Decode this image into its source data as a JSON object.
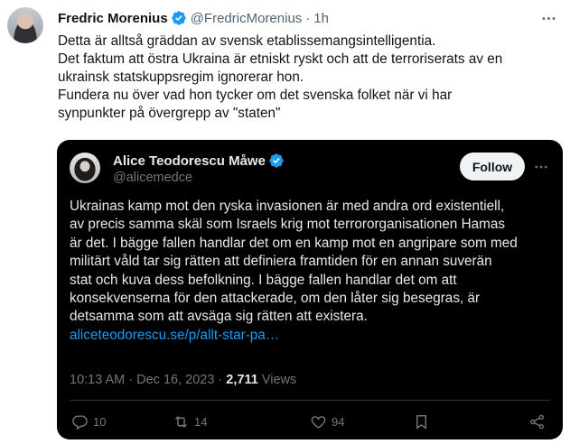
{
  "tweet": {
    "author_name": "Fredric Morenius",
    "author_handle": "@FredricMorenius",
    "separator": "·",
    "time": "1h",
    "text_lines": [
      "Detta är alltså gräddan av svensk etablissemangsintelligentia.",
      "Det faktum att östra Ukraina är etniskt ryskt och att de terroriserats av en",
      "ukrainsk statskuppsregim ignorerar hon.",
      "Fundera nu över vad hon tycker om det svenska folket när vi har",
      "synpunkter på övergrepp av \"staten\""
    ]
  },
  "quote": {
    "author_name": "Alice Teodorescu Måwe",
    "author_handle": "@alicemedce",
    "follow_label": "Follow",
    "text_lines": [
      "Ukrainas kamp mot den ryska invasionen är med andra ord existentiell,",
      "av precis samma skäl som Israels krig mot terrororganisationen Hamas",
      "är det. I bägge fallen handlar det om en kamp mot en angripare som med",
      "militärt våld tar sig rätten att definiera framtiden för en annan suverän",
      "stat och kuva dess befolkning. I bägge fallen handlar det om att",
      "konsekvenserna för den attackerade, om den låter sig besegras, är",
      "detsamma som att avsäga sig rätten att existera."
    ],
    "link": "aliceteodorescu.se/p/allt-star-pa…",
    "timestamp": "10:13 AM · Dec 16, 2023 · ",
    "views_count": "2,711",
    "views_label": " Views",
    "actions": {
      "replies": "10",
      "reposts": "14",
      "likes": "94"
    }
  },
  "colors": {
    "accent": "#1d9bf0",
    "text_dark": "#0f1419",
    "text_muted": "#536471",
    "quote_bg": "#000000"
  },
  "icons": [
    "verified-badge-icon",
    "more-options-icon",
    "reply-icon",
    "repost-icon",
    "like-icon",
    "bookmark-icon",
    "share-icon"
  ]
}
